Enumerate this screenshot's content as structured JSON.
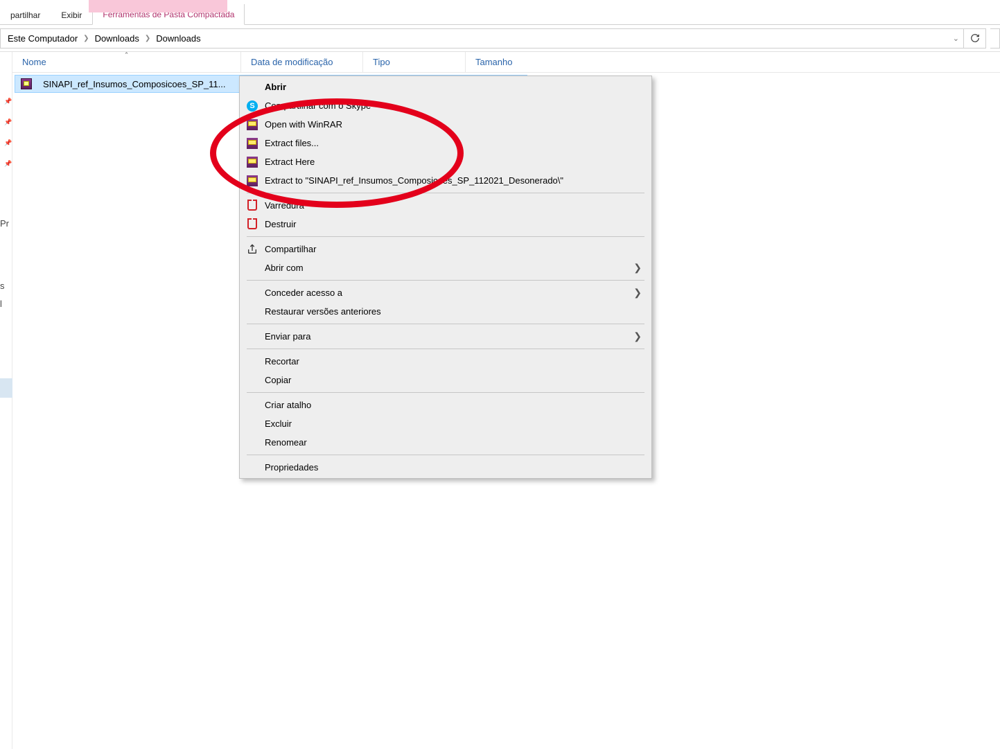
{
  "ribbon": {
    "tabs": [
      "partilhar",
      "Exibir"
    ],
    "contextual_group": "",
    "contextual_tab": "Ferramentas de Pasta Compactada"
  },
  "breadcrumb": {
    "items": [
      "Este Computador",
      "Downloads",
      "Downloads"
    ]
  },
  "columns": {
    "name": "Nome",
    "date": "Data de modificação",
    "type": "Tipo",
    "size": "Tamanho"
  },
  "files": [
    {
      "name": "SINAPI_ref_Insumos_Composicoes_SP_11..."
    }
  ],
  "nav_fragments": {
    "a": "Pr",
    "b": "s",
    "c": "l"
  },
  "context_menu": {
    "abrir": "Abrir",
    "skype": "Compartilhar com o Skype",
    "open_winrar": "Open with WinRAR",
    "extract_files": "Extract files...",
    "extract_here": "Extract Here",
    "extract_to": "Extract to \"SINAPI_ref_Insumos_Composicoes_SP_112021_Desonerado\\\"",
    "varredura": "Varredura",
    "destruir": "Destruir",
    "compartilhar": "Compartilhar",
    "abrir_com": "Abrir com",
    "conceder": "Conceder acesso a",
    "restaurar": "Restaurar versões anteriores",
    "enviar": "Enviar para",
    "recortar": "Recortar",
    "copiar": "Copiar",
    "atalho": "Criar atalho",
    "excluir": "Excluir",
    "renomear": "Renomear",
    "propriedades": "Propriedades"
  }
}
